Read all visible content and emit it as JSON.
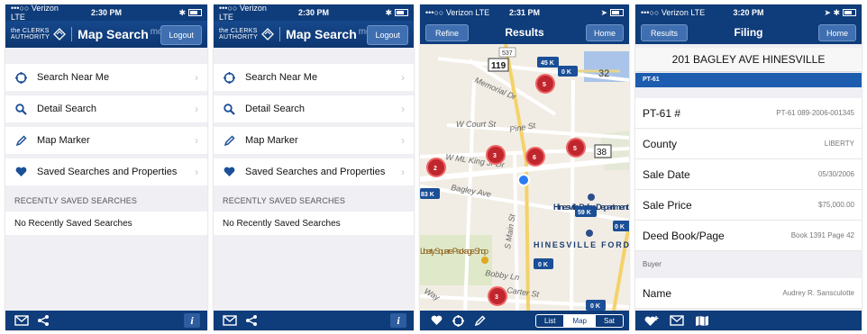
{
  "screen1": {
    "status": {
      "carrier": "•••○○ Verizon  LTE",
      "time": "2:30 PM"
    },
    "logo_line1": "the CLERKS",
    "logo_line2": "AUTHORITY",
    "title": "Map Search",
    "title_sub": "mobile",
    "logout": "Logout",
    "menu": [
      {
        "label": "Search Near Me",
        "icon": "target-icon"
      },
      {
        "label": "Detail Search",
        "icon": "search-icon"
      },
      {
        "label": "Map Marker",
        "icon": "pencil-icon"
      },
      {
        "label": "Saved Searches and Properties",
        "icon": "heart-icon"
      }
    ],
    "section": "RECENTLY SAVED SEARCHES",
    "empty": "No Recently Saved Searches"
  },
  "screen2": {
    "status": {
      "carrier": "•••○○ Verizon  LTE",
      "time": "2:30 PM"
    },
    "logo_line1": "the CLERKS",
    "logo_line2": "AUTHORITY",
    "title": "Map Search",
    "title_sub": "mobile",
    "logout": "Logout",
    "menu": [
      {
        "label": "Search Near Me",
        "icon": "target-icon"
      },
      {
        "label": "Detail Search",
        "icon": "search-icon"
      },
      {
        "label": "Map Marker",
        "icon": "pencil-icon"
      },
      {
        "label": "Saved Searches and Properties",
        "icon": "heart-icon"
      }
    ],
    "section": "RECENTLY SAVED SEARCHES",
    "empty": "No Recently Saved Searches"
  },
  "screen3": {
    "status": {
      "carrier": "•••○○ Verizon  LTE",
      "time": "2:31 PM"
    },
    "refine": "Refine",
    "title": "Results",
    "home": "Home",
    "map_labels": {
      "r537": "537",
      "r119": "119",
      "r32": "32",
      "r38": "38",
      "memorial": "Memorial Dr",
      "court": "W Court St",
      "pine": "Pine St",
      "mlk": "W ML King Jr Dr",
      "bagley": "Bagley Ave",
      "main": "S Main St",
      "police": "Hinesville Police Department",
      "ford": "HINESVILLE FORD",
      "liberty": "Liberty Square Package Shop",
      "bobby": "Bobby Ln",
      "carter": "Carter St",
      "way": "Way"
    },
    "pins": [
      "45 K",
      "0 K",
      "83 K",
      "59 K",
      "0 K",
      "0 K",
      "0 K"
    ],
    "clusters": [
      "5",
      "3",
      "6",
      "5",
      "2",
      "3"
    ],
    "seg": [
      "List",
      "Map",
      "Sat"
    ]
  },
  "screen4": {
    "status": {
      "carrier": "•••○○ Verizon  LTE",
      "time": "3:20 PM"
    },
    "back": "Results",
    "title": "Filing",
    "home": "Home",
    "address": "201 BAGLEY AVE HINESVILLE",
    "strip": "PT-61",
    "fields": [
      {
        "k": "PT-61 #",
        "v": "PT-61 089-2006-001345"
      },
      {
        "k": "County",
        "v": "LIBERTY"
      },
      {
        "k": "Sale Date",
        "v": "05/30/2006"
      },
      {
        "k": "Sale Price",
        "v": "$75,000.00"
      },
      {
        "k": "Deed Book/Page",
        "v": "Book 1391 Page 42"
      }
    ],
    "section": "Buyer",
    "name": {
      "k": "Name",
      "v": "Audrey R. Sansculotte"
    }
  },
  "colors": {
    "nav": "#0f3c7a",
    "accent": "#1d5cae",
    "cluster": "#c0262d",
    "pin": "#1b4f97"
  }
}
